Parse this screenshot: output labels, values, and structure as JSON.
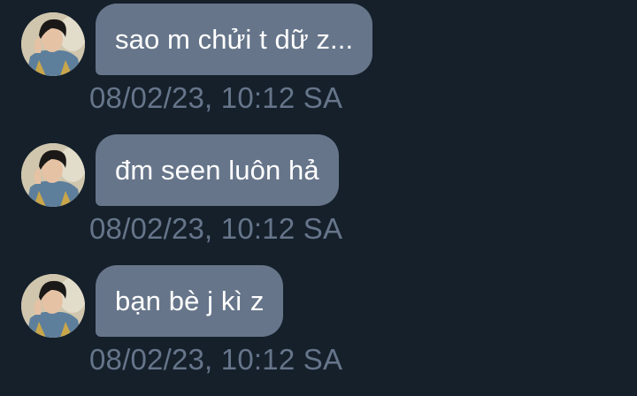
{
  "conversation": {
    "messages": [
      {
        "text": "sao m chửi t dữ z...",
        "timestamp": "08/02/23, 10:12 SA",
        "avatar_icon": "user-avatar-icon"
      },
      {
        "text": "đm seen luôn hả",
        "timestamp": "08/02/23, 10:12 SA",
        "avatar_icon": "user-avatar-icon"
      },
      {
        "text": "bạn bè j kì z",
        "timestamp": "08/02/23, 10:12 SA",
        "avatar_icon": "user-avatar-icon"
      }
    ]
  },
  "theme": {
    "background": "#15202b",
    "bubble": "#66758a",
    "bubble_text": "#ffffff",
    "timestamp": "#66758a"
  }
}
